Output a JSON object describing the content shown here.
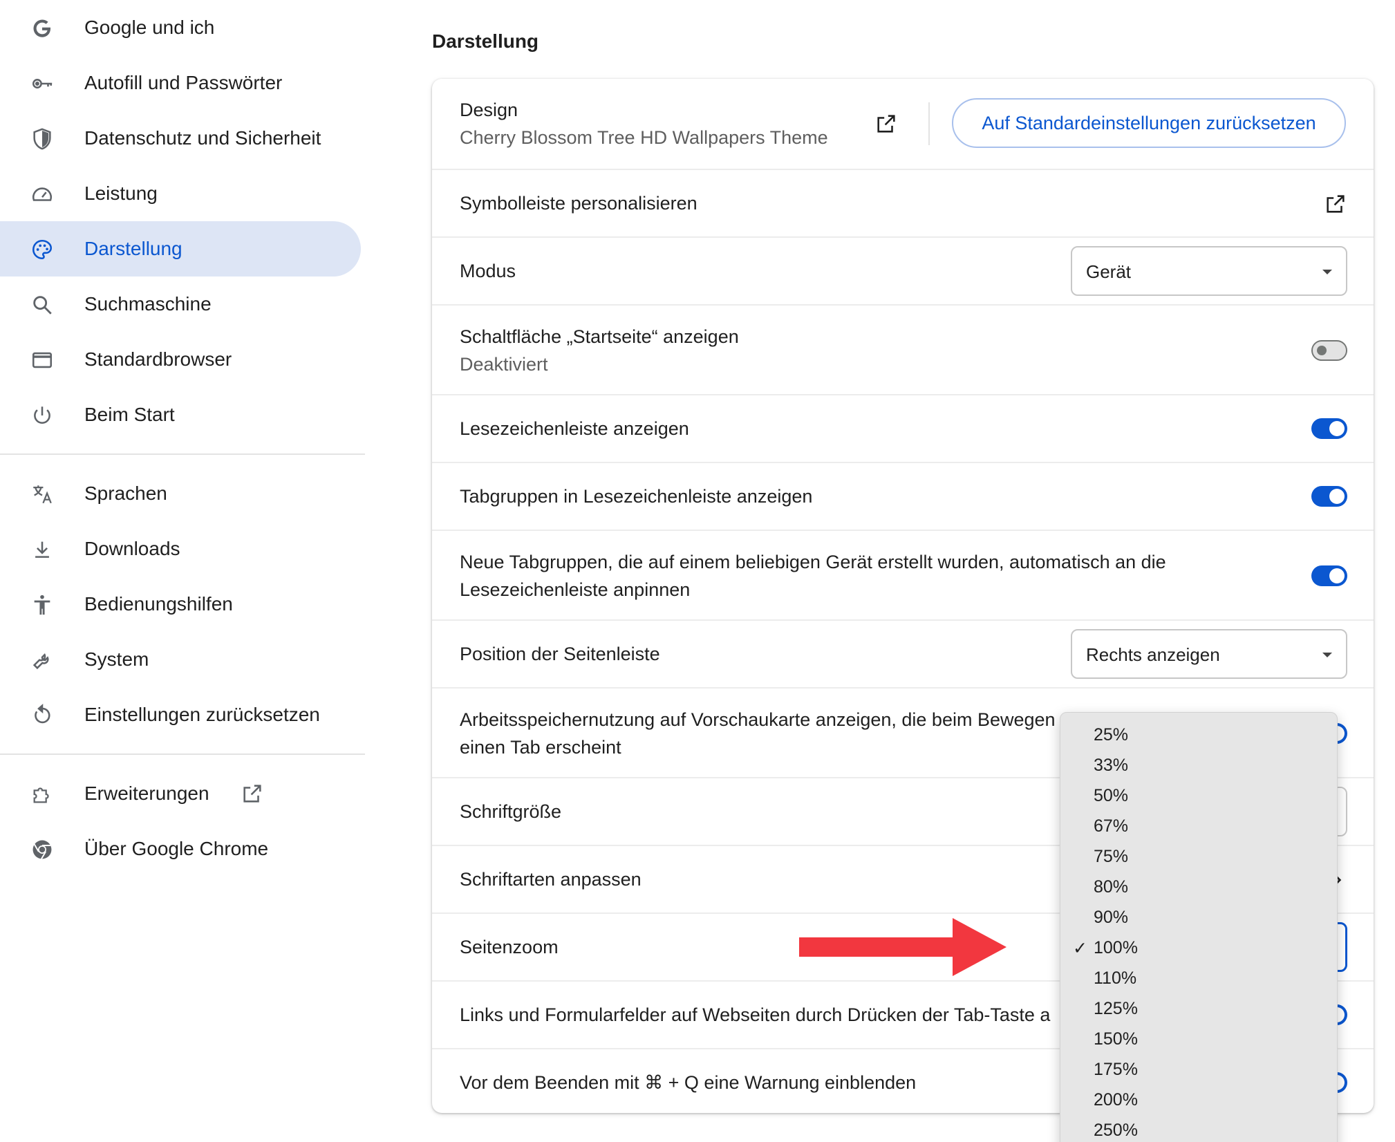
{
  "sidebar": {
    "items": [
      {
        "label": "Google und ich",
        "icon": "google-g-icon"
      },
      {
        "label": "Autofill und Passwörter",
        "icon": "key-icon"
      },
      {
        "label": "Datenschutz und Sicherheit",
        "icon": "shield-icon"
      },
      {
        "label": "Leistung",
        "icon": "speedometer-icon"
      },
      {
        "label": "Darstellung",
        "icon": "palette-icon",
        "active": true
      },
      {
        "label": "Suchmaschine",
        "icon": "search-icon"
      },
      {
        "label": "Standardbrowser",
        "icon": "browser-window-icon"
      },
      {
        "label": "Beim Start",
        "icon": "power-icon"
      },
      {
        "label": "Sprachen",
        "icon": "translate-icon"
      },
      {
        "label": "Downloads",
        "icon": "download-icon"
      },
      {
        "label": "Bedienungshilfen",
        "icon": "accessibility-icon"
      },
      {
        "label": "System",
        "icon": "wrench-icon"
      },
      {
        "label": "Einstellungen zurücksetzen",
        "icon": "reset-icon"
      },
      {
        "label": "Erweiterungen",
        "icon": "puzzle-icon"
      },
      {
        "label": "Über Google Chrome",
        "icon": "chrome-icon"
      }
    ]
  },
  "main": {
    "section_title": "Darstellung",
    "design": {
      "label": "Design",
      "value": "Cherry Blossom Tree HD Wallpapers Theme",
      "reset_button": "Auf Standardeinstellungen zurücksetzen"
    },
    "toolbar": {
      "label": "Symbolleiste personalisieren"
    },
    "mode": {
      "label": "Modus",
      "selected": "Gerät"
    },
    "home_button": {
      "label": "Schaltfläche „Startseite“ anzeigen",
      "status": "Deaktiviert",
      "enabled": false
    },
    "bookmarks_bar": {
      "label": "Lesezeichenleiste anzeigen",
      "enabled": true
    },
    "tab_groups": {
      "label": "Tabgruppen in Lesezeichenleiste anzeigen",
      "enabled": true
    },
    "pin_groups": {
      "label_line1": "Neue Tabgruppen, die auf einem beliebigen Gerät erstellt wurden, automatisch an die",
      "label_line2": "Lesezeichenleiste anpinnen",
      "enabled": true
    },
    "side_panel": {
      "label": "Position der Seitenleiste",
      "selected": "Rechts anzeigen"
    },
    "memory": {
      "label_line1": "Arbeitsspeichernutzung auf Vorschaukarte anzeigen, die beim Bewegen",
      "label_line2": "einen Tab erscheint"
    },
    "font_size": {
      "label": "Schriftgröße"
    },
    "fonts": {
      "label": "Schriftarten anpassen"
    },
    "page_zoom": {
      "label": "Seitenzoom"
    },
    "tab_links": {
      "label": "Links und Formularfelder auf Webseiten durch Drücken der Tab-Taste a"
    },
    "quit_warning": {
      "label": "Vor dem Beenden mit ⌘ + Q eine Warnung einblenden"
    }
  },
  "zoom_dropdown": {
    "options": [
      "25%",
      "33%",
      "50%",
      "67%",
      "75%",
      "80%",
      "90%",
      "100%",
      "110%",
      "125%",
      "150%",
      "175%",
      "200%",
      "250%"
    ],
    "selected": "100%",
    "check_glyph": "✓"
  },
  "colors": {
    "accent": "#0b57d0",
    "active_nav_bg": "#dde5f5",
    "annotation_arrow": "#f2373f"
  }
}
